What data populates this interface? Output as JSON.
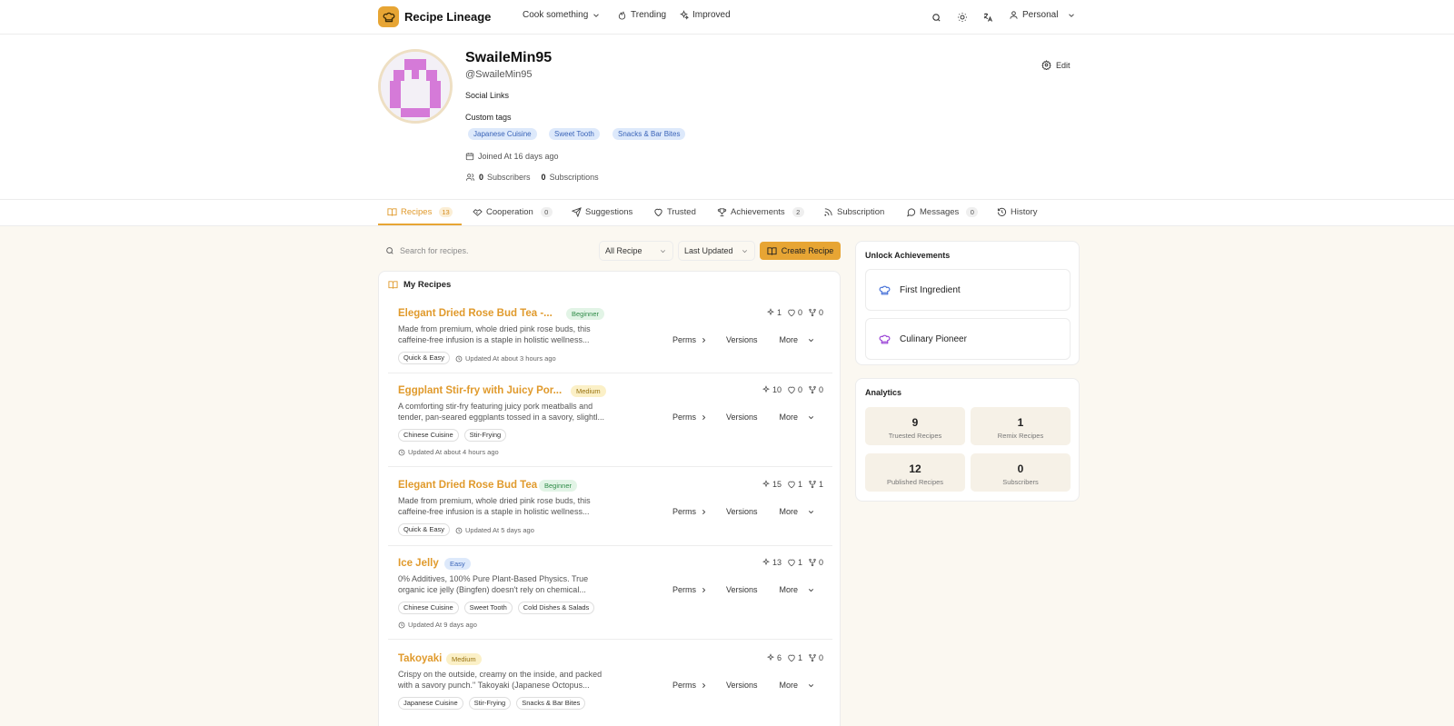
{
  "app": {
    "brand": "Recipe Lineage",
    "nav": [
      "Cook something",
      "Trending",
      "Improved"
    ],
    "account_label": "Personal"
  },
  "profile": {
    "display_name": "SwaileMin95",
    "handle": "@SwaileMin95",
    "social_links_label": "Social Links",
    "custom_tags_label": "Custom tags",
    "tags": [
      "Japanese Cuisine",
      "Sweet Tooth",
      "Snacks & Bar Bites"
    ],
    "joined": "Joined At 16 days ago",
    "subscribers_count": "0",
    "subscribers_label": "Subscribers",
    "subscriptions_count": "0",
    "subscriptions_label": "Subscriptions",
    "edit_label": "Edit"
  },
  "tabs": [
    {
      "label": "Recipes",
      "count": "13",
      "icon": "book-icon"
    },
    {
      "label": "Cooperation",
      "count": "0",
      "icon": "handshake-icon"
    },
    {
      "label": "Suggestions",
      "count": null,
      "icon": "send-icon"
    },
    {
      "label": "Trusted",
      "count": null,
      "icon": "heart-icon"
    },
    {
      "label": "Achievements",
      "count": "2",
      "icon": "trophy-icon"
    },
    {
      "label": "Subscription",
      "count": null,
      "icon": "rss-icon"
    },
    {
      "label": "Messages",
      "count": "0",
      "icon": "message-icon"
    },
    {
      "label": "History",
      "count": null,
      "icon": "history-icon"
    }
  ],
  "toolbar": {
    "search_placeholder": "Search for recipes.",
    "filter_value": "All Recipe",
    "sort_value": "Last Updated",
    "create_label": "Create Recipe"
  },
  "recipes_panel": {
    "title": "My Recipes",
    "actions": {
      "perms": "Perms",
      "versions": "Versions",
      "more": "More"
    },
    "items": [
      {
        "title": "Elegant Dried Rose Bud Tea -...",
        "difficulty": "Beginner",
        "difficulty_color": "green",
        "description": "Made from premium, whole dried pink rose buds, this caffeine-free infusion is a staple in holistic wellness...",
        "tags": [
          "Quick & Easy"
        ],
        "updated": "Updated At about 3 hours ago",
        "stats": [
          "1",
          "0",
          "0"
        ]
      },
      {
        "title": "Eggplant Stir-fry with Juicy Por...",
        "difficulty": "Medium",
        "difficulty_color": "yellow",
        "description": "A comforting stir-fry featuring juicy pork meatballs and tender, pan-seared eggplants tossed in a savory, slightl...",
        "tags": [
          "Chinese Cuisine",
          "Stir-Frying"
        ],
        "updated": "Updated At about 4 hours ago",
        "stats": [
          "10",
          "0",
          "0"
        ]
      },
      {
        "title": "Elegant Dried Rose Bud Tea",
        "difficulty": "Beginner",
        "difficulty_color": "green",
        "description": "Made from premium, whole dried pink rose buds, this caffeine-free infusion is a staple in holistic wellness...",
        "tags": [
          "Quick & Easy"
        ],
        "updated": "Updated At 5 days ago",
        "stats": [
          "15",
          "1",
          "1"
        ]
      },
      {
        "title": "Ice Jelly",
        "difficulty": "Easy",
        "difficulty_color": "blue",
        "description": "0% Additives, 100% Pure Plant-Based Physics. True organic ice jelly (Bingfen) doesn't rely on chemical...",
        "tags": [
          "Chinese Cuisine",
          "Sweet Tooth",
          "Cold Dishes & Salads"
        ],
        "updated": "Updated At 9 days ago",
        "stats": [
          "13",
          "1",
          "0"
        ]
      },
      {
        "title": "Takoyaki",
        "difficulty": "Medium",
        "difficulty_color": "yellow",
        "description": "Crispy on the outside, creamy on the inside, and packed with a savory punch.\" Takoyaki (Japanese Octopus...",
        "tags": [
          "Japanese Cuisine",
          "Stir-Frying",
          "Snacks & Bar Bites"
        ],
        "updated": "",
        "stats": [
          "6",
          "1",
          "0"
        ]
      }
    ]
  },
  "achievements": {
    "title": "Unlock Achievements",
    "items": [
      {
        "label": "First Ingredient",
        "color": "#4a74d9"
      },
      {
        "label": "Culinary Pioneer",
        "color": "#9b45d6"
      }
    ]
  },
  "analytics": {
    "title": "Analytics",
    "stats": [
      {
        "value": "9",
        "label": "Truested Recipes"
      },
      {
        "value": "1",
        "label": "Remix Recipes"
      },
      {
        "value": "12",
        "label": "Published Recipes"
      },
      {
        "value": "0",
        "label": "Subscribers"
      }
    ]
  },
  "colors": {
    "accent": "#e7a534",
    "accent_text": "#e09a2c",
    "page_bg": "#fbf8f1"
  }
}
